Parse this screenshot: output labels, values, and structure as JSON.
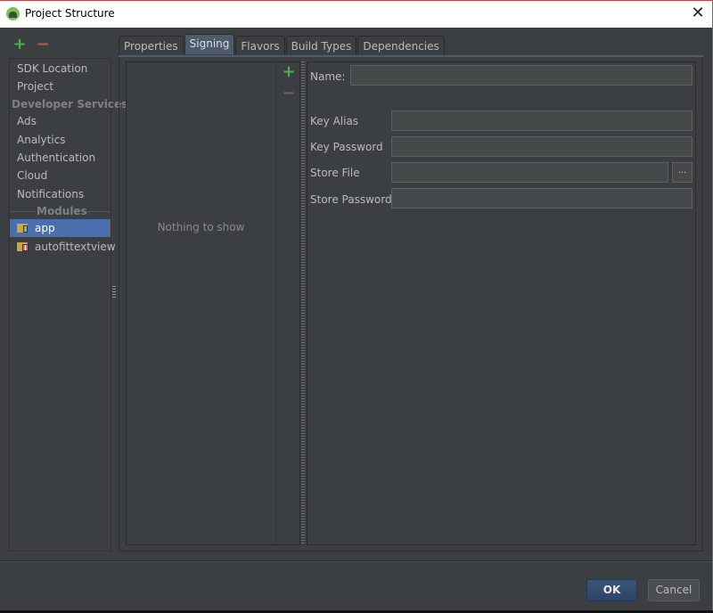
{
  "window": {
    "title": "Project Structure",
    "close_symbol": "✕"
  },
  "sidebar": {
    "add_symbol": "+",
    "remove_symbol": "−",
    "items_top": [
      {
        "label": "SDK Location"
      },
      {
        "label": "Project"
      }
    ],
    "developer_services_header": "Developer Services",
    "services": [
      {
        "label": "Ads"
      },
      {
        "label": "Analytics"
      },
      {
        "label": "Authentication"
      },
      {
        "label": "Cloud"
      },
      {
        "label": "Notifications"
      }
    ],
    "modules_header": "Modules",
    "modules": [
      {
        "label": "app",
        "icon": "android-module-icon",
        "selected": true
      },
      {
        "label": "autofittextview",
        "icon": "library-module-icon",
        "selected": false
      }
    ]
  },
  "tabs": [
    {
      "label": "Properties",
      "active": false
    },
    {
      "label": "Signing",
      "active": true
    },
    {
      "label": "Flavors",
      "active": false
    },
    {
      "label": "Build Types",
      "active": false
    },
    {
      "label": "Dependencies",
      "active": false
    }
  ],
  "signing_list": {
    "empty_text": "Nothing to show",
    "add_symbol": "+",
    "remove_symbol": "−"
  },
  "form": {
    "name_label": "Name:",
    "name_value": "",
    "key_alias_label": "Key Alias",
    "key_alias_value": "",
    "key_password_label": "Key Password",
    "key_password_value": "",
    "store_file_label": "Store File",
    "store_file_value": "",
    "browse_label": "...",
    "store_password_label": "Store Password",
    "store_password_value": ""
  },
  "buttons": {
    "ok": "OK",
    "cancel": "Cancel"
  },
  "colors": {
    "background": "#3c3f41",
    "selection": "#4b6eaf",
    "add_green": "#4caf50",
    "remove_red": "#c75450",
    "window_border": "#c8424b"
  }
}
